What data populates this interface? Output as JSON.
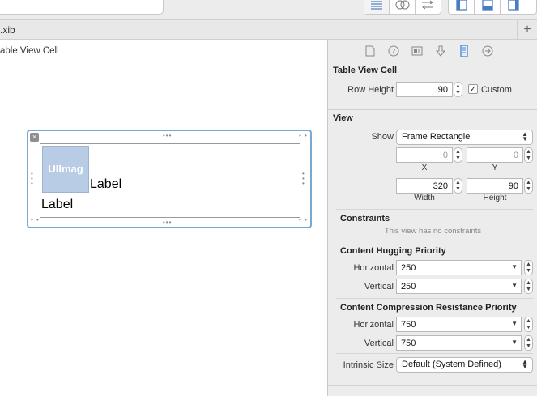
{
  "tab": {
    "file_label": ".xib",
    "add_label": "+"
  },
  "jumpbar": {
    "label": "able View Cell"
  },
  "canvas": {
    "image_view_label": "UIImag",
    "label_one": "Label",
    "label_two": "Label",
    "close_glyph": "×"
  },
  "inspector": {
    "tabs": [
      "file-icon",
      "help-icon",
      "identity-icon",
      "attributes-icon",
      "size-icon",
      "connections-icon"
    ],
    "table_view_cell": {
      "title": "Table View Cell",
      "row_height_label": "Row Height",
      "row_height_value": "90",
      "custom_label": "Custom",
      "custom_checked": true
    },
    "view": {
      "title": "View",
      "show_label": "Show",
      "show_value": "Frame Rectangle",
      "x_value": "0",
      "y_value": "0",
      "x_label": "X",
      "y_label": "Y",
      "width_value": "320",
      "height_value": "90",
      "width_label": "Width",
      "height_label": "Height"
    },
    "constraints": {
      "title": "Constraints",
      "hint": "This view has no constraints"
    },
    "hugging": {
      "title": "Content Hugging Priority",
      "horizontal_label": "Horizontal",
      "horizontal_value": "250",
      "vertical_label": "Vertical",
      "vertical_value": "250"
    },
    "compression": {
      "title": "Content Compression Resistance Priority",
      "horizontal_label": "Horizontal",
      "horizontal_value": "750",
      "vertical_label": "Vertical",
      "vertical_value": "750"
    },
    "intrinsic": {
      "label": "Intrinsic Size",
      "value": "Default (System Defined)"
    }
  },
  "colors": {
    "selection_border": "#79a8d4",
    "image_view_fill": "#b9cce6",
    "inspector_bg": "#ececec",
    "active_tab_icon": "#3b87e0"
  }
}
